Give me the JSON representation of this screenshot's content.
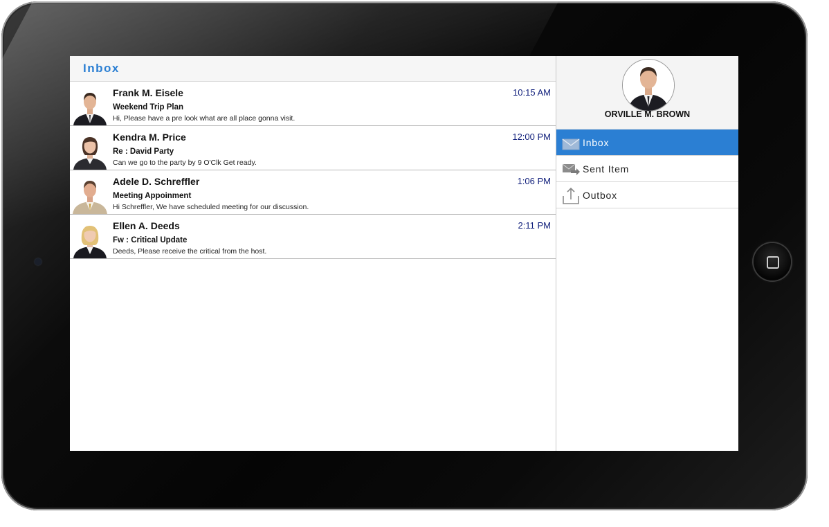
{
  "inbox": {
    "title": "Inbox",
    "messages": [
      {
        "sender": "Frank M. Eisele",
        "time": "10:15 AM",
        "subject": "Weekend Trip Plan",
        "preview": "Hi, Please have a pre look what are all place gonna visit."
      },
      {
        "sender": "Kendra M. Price",
        "time": "12:00 PM",
        "subject": "Re : David Party",
        "preview": "Can we go to the party by 9 O'Clk Get ready."
      },
      {
        "sender": "Adele D. Schreffler",
        "time": "1:06 PM",
        "subject": "Meeting Appoinment",
        "preview": "Hi Schreffler, We have scheduled meeting for our discussion."
      },
      {
        "sender": "Ellen A. Deeds",
        "time": "2:11 PM",
        "subject": "Fw : Critical Update",
        "preview": "Deeds, Please receive the critical from the host."
      }
    ]
  },
  "profile": {
    "name": "ORVILLE M. BROWN"
  },
  "nav": {
    "items": [
      {
        "label": "Inbox",
        "icon": "envelope-icon",
        "active": true
      },
      {
        "label": "Sent Item",
        "icon": "sent-mail-icon",
        "active": false
      },
      {
        "label": "Outbox",
        "icon": "upload-icon",
        "active": false
      }
    ]
  },
  "colors": {
    "accent": "#2b7fd3",
    "time_text": "#0e1d7a",
    "bezel": "#050505"
  }
}
